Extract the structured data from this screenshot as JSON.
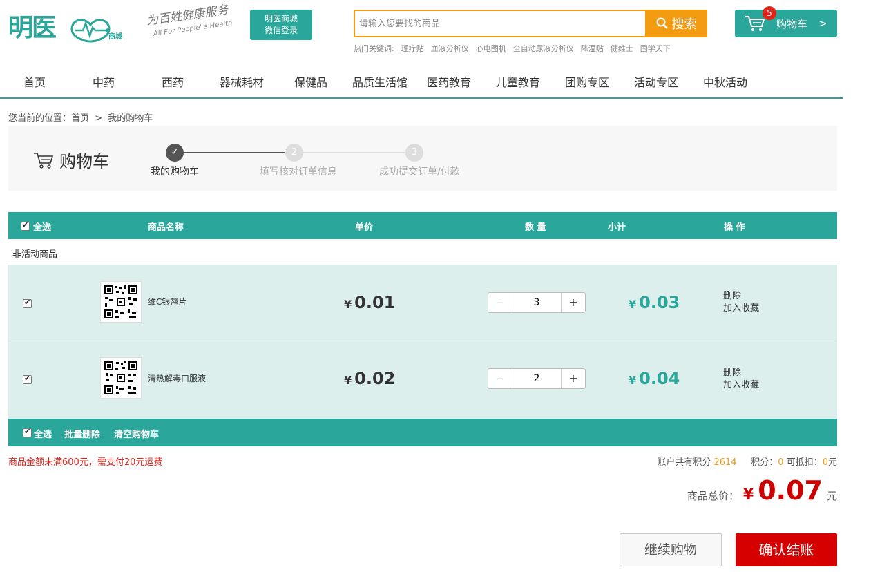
{
  "header": {
    "logo_text": "明医",
    "logo_sub": "商城",
    "slogan_cn": "为百姓健康服务",
    "slogan_en": "All For People' s Health",
    "wechat_login": [
      "明医商城",
      "微信登录"
    ],
    "search_placeholder": "请输入您要找的商品",
    "search_button": "搜索",
    "hot_label": "热门关键词:",
    "hot_keywords": [
      "理疗贴",
      "血液分析仪",
      "心电图机",
      "全自动尿液分析仪",
      "降温贴",
      "健维士",
      "国学天下"
    ],
    "cart_label": "购物车",
    "cart_arrow": ">",
    "cart_count": "5"
  },
  "nav": [
    "首页",
    "中药",
    "西药",
    "器械耗材",
    "保健品",
    "品质生活馆",
    "医药教育",
    "儿童教育",
    "团购专区",
    "活动专区",
    "中秋活动"
  ],
  "breadcrumb": {
    "prefix": "您当前的位置：",
    "home": "首页",
    "sep": ">",
    "current": "我的购物车"
  },
  "steps": {
    "title": "购物车",
    "items": [
      {
        "num": "✓",
        "label": "我的购物车",
        "active": true
      },
      {
        "num": "2",
        "label": "填写核对订单信息",
        "active": false
      },
      {
        "num": "3",
        "label": "成功提交订单/付款",
        "active": false
      }
    ]
  },
  "table": {
    "headers": {
      "select_all": "全选",
      "name": "商品名称",
      "price": "单价",
      "qty": "数 量",
      "subtotal": "小计",
      "ops": "操 作"
    },
    "group_label": "非活动商品",
    "currency": "¥",
    "rows": [
      {
        "name": "维C银翘片",
        "price": "0.01",
        "qty": "3",
        "subtotal": "0.03",
        "delete": "删除",
        "favorite": "加入收藏"
      },
      {
        "name": "清热解毒口服液",
        "price": "0.02",
        "qty": "2",
        "subtotal": "0.04",
        "delete": "删除",
        "favorite": "加入收藏"
      }
    ],
    "footer": {
      "select_all": "全选",
      "batch_delete": "批量删除",
      "clear_cart": "清空购物车"
    }
  },
  "summary": {
    "shipping_note": "商品金额未满600元，需支付20元运费",
    "points_label": "账户共有积分",
    "points_total": "2614",
    "points_use_label": "积分：",
    "points_use": "0",
    "deduct_label": "可抵扣：",
    "deduct_value": "0",
    "deduct_unit": "元",
    "total_label": "商品总价：",
    "total_currency": "¥",
    "total_amount": "0.07",
    "total_unit": "元"
  },
  "actions": {
    "continue": "继续购物",
    "checkout": "确认结账"
  },
  "colors": {
    "primary": "#2aa79a",
    "accent": "#f39c12",
    "danger": "#d60000"
  }
}
